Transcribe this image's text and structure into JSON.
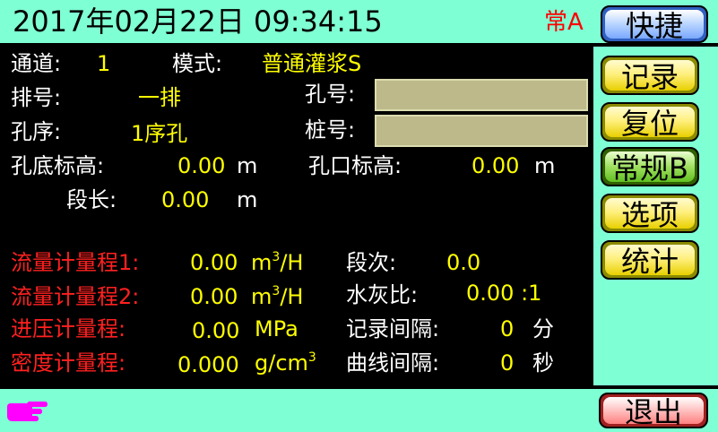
{
  "header": {
    "datetime": "2017年02月22日  09:34:15",
    "mode_indicator": "常A",
    "quick_button": "快捷"
  },
  "main": {
    "channel_label": "通道:",
    "channel_value": "1",
    "mode_label": "模式:",
    "mode_value": "普通灌浆S",
    "row_label": "排号:",
    "row_value": "一排",
    "hole_no_label": "孔号:",
    "hole_no_value": "",
    "hole_seq_label": "孔序:",
    "hole_seq_value": "1序孔",
    "pile_no_label": "桩号:",
    "pile_no_value": "",
    "bottom_elev_label": "孔底标高:",
    "bottom_elev_value": "0.00",
    "bottom_elev_unit": "m",
    "top_elev_label": "孔口标高:",
    "top_elev_value": "0.00",
    "top_elev_unit": "m",
    "segment_len_label": "段长:",
    "segment_len_value": "0.00",
    "segment_len_unit": "m",
    "flow_range1_label": "流量计量程1:",
    "flow_range1_value": "0.00",
    "flow_range1_unit_base": "m",
    "flow_range1_unit_sup": "3",
    "flow_range1_unit_tail": "/H",
    "flow_range2_label": "流量计量程2:",
    "flow_range2_value": "0.00",
    "flow_range2_unit_base": "m",
    "flow_range2_unit_sup": "3",
    "flow_range2_unit_tail": "/H",
    "pressure_range_label": "进压计量程:",
    "pressure_range_value": "0.00",
    "pressure_range_unit": "MPa",
    "density_range_label": "密度计量程:",
    "density_range_value": "0.000",
    "density_range_unit_base": "g/cm",
    "density_range_unit_sup": "3",
    "segment_no_label": "段次:",
    "segment_no_value": "0.0",
    "wc_ratio_label": "水灰比:",
    "wc_ratio_value": "0.00 :1",
    "record_interval_label": "记录间隔:",
    "record_interval_value": "0",
    "record_interval_unit": "分",
    "curve_interval_label": "曲线间隔:",
    "curve_interval_value": "0",
    "curve_interval_unit": "秒"
  },
  "sidebar": {
    "record_button": "记录",
    "reset_button": "复位",
    "normal_button": "常规B",
    "options_button": "选项",
    "stats_button": "统计"
  },
  "footer": {
    "exit_button": "退出",
    "pointer_icon": "hand-pointer-icon"
  },
  "colors": {
    "teal": "#7fffd4",
    "label": "#ffffff",
    "value": "#ffff00",
    "range_label": "#ff2020",
    "pointer": "#ff00ff"
  }
}
